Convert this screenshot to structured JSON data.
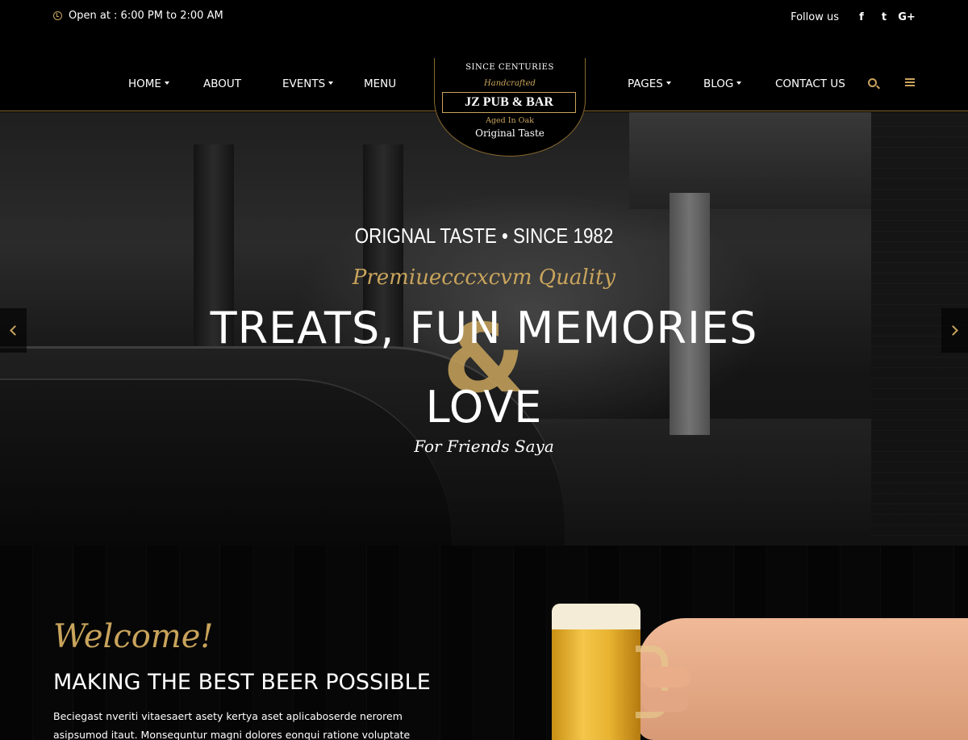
{
  "topbar": {
    "open_hours": "Open at : 6:00 PM to 2:00 AM",
    "follow_label": "Follow us",
    "social": [
      {
        "name": "facebook-icon",
        "glyph": "f"
      },
      {
        "name": "twitter-icon",
        "glyph": "t"
      },
      {
        "name": "google-plus-icon",
        "glyph": "G+"
      }
    ]
  },
  "nav": {
    "home": "HOME",
    "about": "ABOUT",
    "events": "EVENTS",
    "menu": "MENU",
    "pages": "PAGES",
    "blog": "BLOG",
    "contact": "CONTACT US"
  },
  "logo": {
    "since": "SINCE CENTURIES",
    "handcrafted": "Handcrafted",
    "name": "JZ PUB & BAR",
    "aged": "Aged In Oak",
    "original": "Original Taste"
  },
  "hero": {
    "subtitle": "ORIGNAL TASTE • SINCE 1982",
    "quality": "Premiuecccxcvm Quality",
    "title_line1": "TREATS, FUN MEMORIES",
    "ampersand": "&",
    "title_line2": "LOVE",
    "tagline": "For Friends Saya"
  },
  "welcome": {
    "script": "Welcome!",
    "heading": "MAKING THE BEST BEER POSSIBLE",
    "body": "Beciegast nveriti vitaesaert asety kertya aset aplicaboserde nerorem asipsumod itaut. Monsequntur magni dolores eonqui ratione voluptate msequise kertyias"
  },
  "colors": {
    "accent": "#c9a45c",
    "background": "#000000",
    "text": "#ffffff"
  }
}
